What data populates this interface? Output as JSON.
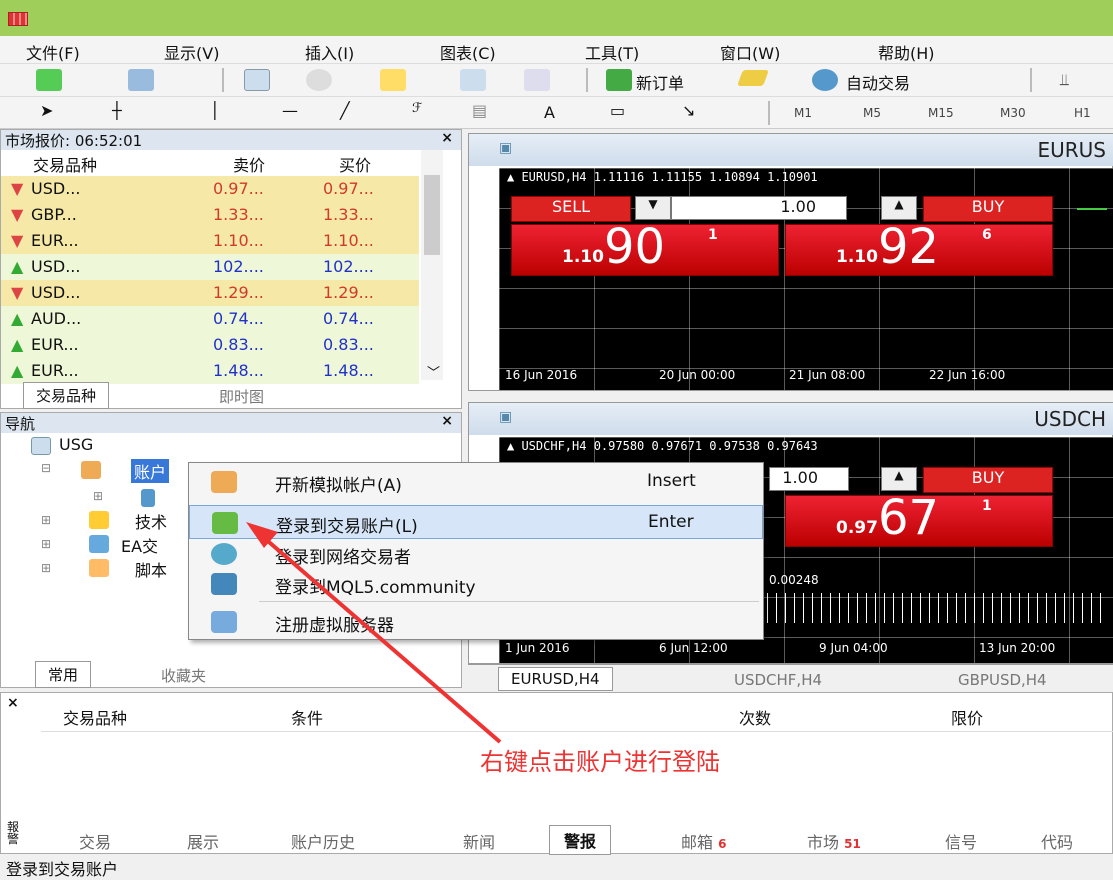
{
  "menu": [
    "文件(F)",
    "显示(V)",
    "插入(I)",
    "图表(C)",
    "工具(T)",
    "窗口(W)",
    "帮助(H)"
  ],
  "toolbar": {
    "new_order": "新订单",
    "auto_trade": "自动交易",
    "timeframes": [
      "M1",
      "M5",
      "M15",
      "M30",
      "H1"
    ],
    "text_tool": "A"
  },
  "market_watch": {
    "title": "市场报价: 06:52:01",
    "headers": [
      "交易品种",
      "卖价",
      "买价"
    ],
    "rows": [
      {
        "sym": "USD...",
        "bid": "0.97...",
        "ask": "0.97...",
        "dir": "down"
      },
      {
        "sym": "GBP...",
        "bid": "1.33...",
        "ask": "1.33...",
        "dir": "down"
      },
      {
        "sym": "EUR...",
        "bid": "1.10...",
        "ask": "1.10...",
        "dir": "down"
      },
      {
        "sym": "USD...",
        "bid": "102....",
        "ask": "102....",
        "dir": "up"
      },
      {
        "sym": "USD...",
        "bid": "1.29...",
        "ask": "1.29...",
        "dir": "down"
      },
      {
        "sym": "AUD...",
        "bid": "0.74...",
        "ask": "0.74...",
        "dir": "up"
      },
      {
        "sym": "EUR...",
        "bid": "0.83...",
        "ask": "0.83...",
        "dir": "up"
      },
      {
        "sym": "EUR...",
        "bid": "1.48...",
        "ask": "1.48...",
        "dir": "up"
      }
    ],
    "tabs": [
      "交易品种",
      "即时图"
    ]
  },
  "navigator": {
    "title": "导航",
    "root": "USG",
    "accounts": "账户",
    "indicators": "技术",
    "ea": "EA交",
    "scripts": "脚本",
    "tabs": [
      "常用",
      "收藏夹"
    ]
  },
  "context_menu": [
    {
      "label": "开新模拟帐户(A)",
      "shortcut": "Insert"
    },
    {
      "label": "登录到交易账户(L)",
      "shortcut": "Enter"
    },
    {
      "label": "登录到网络交易者",
      "shortcut": ""
    },
    {
      "label": "登录到MQL5.community",
      "shortcut": ""
    },
    {
      "label": "注册虚拟服务器",
      "shortcut": ""
    }
  ],
  "chart1": {
    "name": "EURUS",
    "info": "▲ EURUSD,H4  1.11116 1.11155 1.10894 1.10901",
    "sell": "SELL",
    "buy": "BUY",
    "lot": "1.00",
    "sell_small": "1.10",
    "sell_big": "90",
    "sell_sup": "1",
    "buy_small": "1.10",
    "buy_big": "92",
    "buy_sup": "6",
    "times": [
      "16 Jun 2016",
      "20 Jun 00:00",
      "21 Jun 08:00",
      "22 Jun 16:00"
    ]
  },
  "chart2": {
    "name": "USDCH",
    "info": "▲ USDCHF,H4  0.97580 0.97671 0.97538 0.97643",
    "buy": "BUY",
    "lot": "1.00",
    "buy_small": "0.97",
    "buy_big": "67",
    "buy_sup": "1",
    "indicator": "0.00248",
    "times": [
      "1 Jun 2016",
      "6 Jun 12:00",
      "9 Jun 04:00",
      "13 Jun 20:00"
    ]
  },
  "chart_tabs": [
    "EURUSD,H4",
    "USDCHF,H4",
    "GBPUSD,H4"
  ],
  "terminal": {
    "headers": [
      "交易品种",
      "条件",
      "次数",
      "限价"
    ],
    "side": "報警",
    "tabs": [
      "交易",
      "展示",
      "账户历史",
      "新闻",
      "警报",
      "邮箱",
      "市场",
      "信号",
      "代码"
    ],
    "mail_badge": "6",
    "market_badge": "51"
  },
  "annotation": "右键点击账户进行登陆",
  "status": "登录到交易账户"
}
